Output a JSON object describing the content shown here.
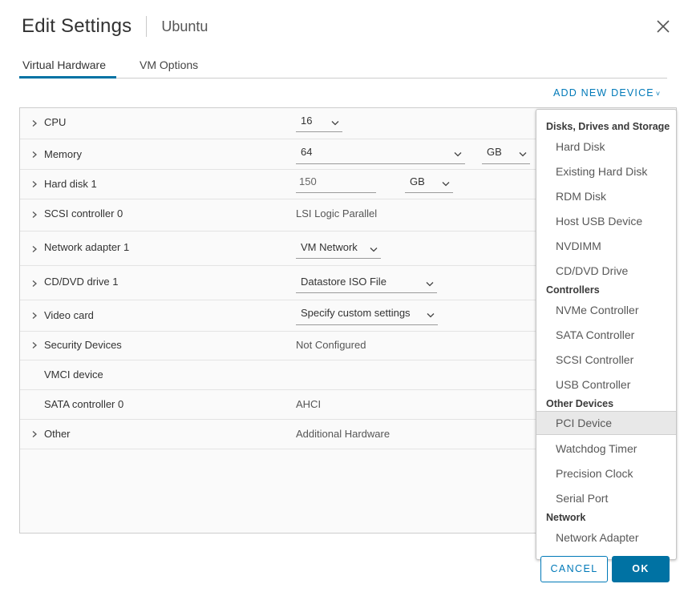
{
  "dialog": {
    "title": "Edit Settings",
    "subtitle": "Ubuntu",
    "close_icon": "close-icon"
  },
  "tabs": [
    {
      "label": "Virtual Hardware",
      "active": true
    },
    {
      "label": "VM Options",
      "active": false
    }
  ],
  "add_device": {
    "label": "ADD NEW DEVICE",
    "chevron": "˅"
  },
  "hardware": {
    "cpu": {
      "label": "CPU",
      "value": "16"
    },
    "memory": {
      "label": "Memory",
      "value": "64",
      "unit": "GB"
    },
    "hard_disk": {
      "label": "Hard disk 1",
      "value": "150",
      "unit": "GB"
    },
    "scsi": {
      "label": "SCSI controller 0",
      "value": "LSI Logic Parallel"
    },
    "network": {
      "label": "Network adapter 1",
      "value": "VM Network"
    },
    "cddvd": {
      "label": "CD/DVD drive 1",
      "value": "Datastore ISO File"
    },
    "video": {
      "label": "Video card",
      "value": "Specify custom settings"
    },
    "security": {
      "label": "Security Devices",
      "value": "Not Configured"
    },
    "vmci": {
      "label": "VMCI device",
      "value": ""
    },
    "sata": {
      "label": "SATA controller 0",
      "value": "AHCI"
    },
    "other": {
      "label": "Other",
      "value": "Additional Hardware"
    }
  },
  "menu": {
    "disks_header": "Disks, Drives and Storage",
    "disks": [
      "Hard Disk",
      "Existing Hard Disk",
      "RDM Disk",
      "Host USB Device",
      "NVDIMM",
      "CD/DVD Drive"
    ],
    "controllers_header": "Controllers",
    "controllers": [
      "NVMe Controller",
      "SATA Controller",
      "SCSI Controller",
      "USB Controller"
    ],
    "other_header": "Other Devices",
    "other": [
      "PCI Device",
      "Watchdog Timer",
      "Precision Clock",
      "Serial Port"
    ],
    "network_header": "Network",
    "network": [
      "Network Adapter"
    ],
    "hovered_item": "PCI Device"
  },
  "footer": {
    "cancel_label": "CANCEL",
    "ok_label": "OK"
  },
  "colors": {
    "accent": "#0072a3",
    "link": "#0079b8",
    "hover": "#e8e8e8"
  }
}
